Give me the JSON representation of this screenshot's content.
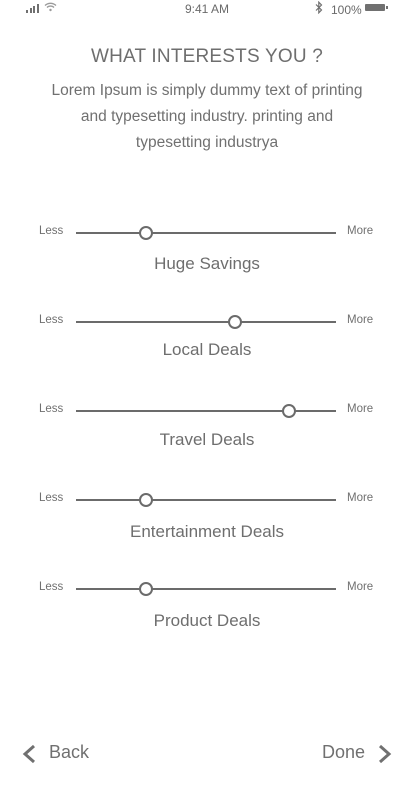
{
  "status_bar": {
    "time": "9:41 AM",
    "battery_percent": "100%",
    "icons": [
      "signal-icon",
      "wifi-icon",
      "bluetooth-icon",
      "battery-icon"
    ]
  },
  "header": {
    "title": "WHAT INTERESTS YOU ?",
    "subtitle": "Lorem Ipsum is simply dummy text of printing and typesetting industry. printing and typesetting industrya"
  },
  "sliders": [
    {
      "label": "Huge Savings",
      "min_label": "Less",
      "max_label": "More",
      "level": 0.27
    },
    {
      "label": "Local Deals",
      "min_label": "Less",
      "max_label": "More",
      "level": 0.61
    },
    {
      "label": "Travel Deals",
      "min_label": "Less",
      "max_label": "More",
      "level": 0.82
    },
    {
      "label": "Entertainment Deals",
      "min_label": "Less",
      "max_label": "More",
      "level": 0.27
    },
    {
      "label": "Product Deals",
      "min_label": "Less",
      "max_label": "More",
      "level": 0.27
    }
  ],
  "footer": {
    "back_label": "Back",
    "done_label": "Done"
  },
  "colors": {
    "text": "#6e6e6e",
    "track": "#6b6b6b",
    "background": "#ffffff"
  }
}
